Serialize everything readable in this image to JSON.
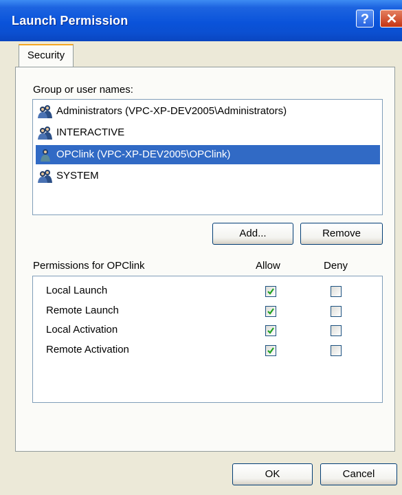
{
  "window": {
    "title": "Launch Permission",
    "help_glyph": "?",
    "close_glyph": "✕"
  },
  "tabs": [
    {
      "label": "Security"
    }
  ],
  "groups": {
    "label": "Group or user names:",
    "items": [
      {
        "label": "Administrators (VPC-XP-DEV2005\\Administrators)",
        "icon": "user-group-icon",
        "selected": false
      },
      {
        "label": "INTERACTIVE",
        "icon": "user-group-icon",
        "selected": false
      },
      {
        "label": "OPClink (VPC-XP-DEV2005\\OPClink)",
        "icon": "user-icon",
        "selected": true
      },
      {
        "label": "SYSTEM",
        "icon": "user-group-icon",
        "selected": false
      }
    ]
  },
  "buttons": {
    "add": "Add...",
    "remove": "Remove",
    "ok": "OK",
    "cancel": "Cancel"
  },
  "permissions": {
    "label": "Permissions for OPClink",
    "allow_header": "Allow",
    "deny_header": "Deny",
    "rows": [
      {
        "name": "Local Launch",
        "allow": true,
        "deny": false
      },
      {
        "name": "Remote Launch",
        "allow": true,
        "deny": false
      },
      {
        "name": "Local Activation",
        "allow": true,
        "deny": false
      },
      {
        "name": "Remote Activation",
        "allow": true,
        "deny": false
      }
    ]
  },
  "colors": {
    "titlebar": "#0a53da",
    "selection": "#316ac5",
    "dialog_bg": "#ece9d8",
    "check": "#21a121"
  }
}
